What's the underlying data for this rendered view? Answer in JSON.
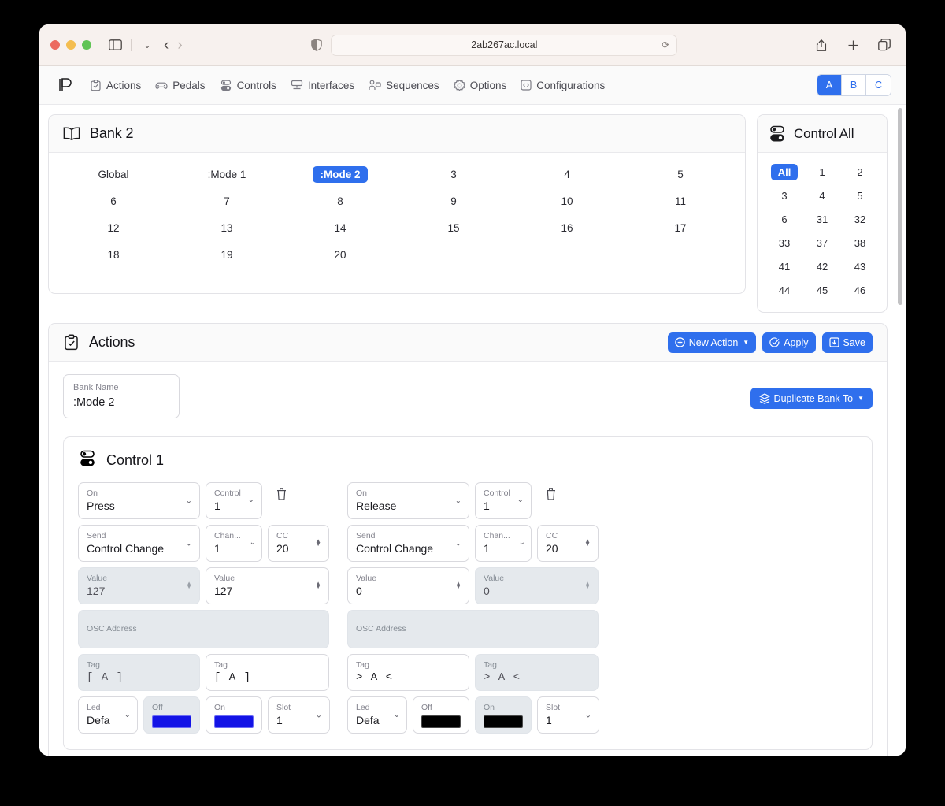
{
  "browser": {
    "url": "2ab267ac.local",
    "icons": {
      "sidebar": "sidebar-icon",
      "sidebar_chevron": "chevron-down-icon",
      "back": "back-arrow-icon",
      "forward": "forward-arrow-icon",
      "shield": "shield-icon",
      "reload": "reload-icon",
      "share": "share-icon",
      "new_tab": "plus-icon",
      "tabs": "tab-overview-icon"
    }
  },
  "appnav": {
    "logo": "pedal-logo-icon",
    "items": [
      {
        "label": "Actions",
        "icon": "clipboard-check-icon"
      },
      {
        "label": "Pedals",
        "icon": "gamepad-icon"
      },
      {
        "label": "Controls",
        "icon": "toggles-icon"
      },
      {
        "label": "Interfaces",
        "icon": "interface-icon"
      },
      {
        "label": "Sequences",
        "icon": "sequences-icon"
      },
      {
        "label": "Options",
        "icon": "gear-icon"
      },
      {
        "label": "Configurations",
        "icon": "config-icon"
      }
    ],
    "abc": {
      "options": [
        "A",
        "B",
        "C"
      ],
      "selected": "A"
    }
  },
  "bank": {
    "title": "Bank 2",
    "icon": "book-icon",
    "cells": [
      {
        "label": "Global",
        "selected": false
      },
      {
        "label": ":Mode 1",
        "selected": false
      },
      {
        "label": ":Mode 2",
        "selected": true
      },
      {
        "label": "3",
        "selected": false
      },
      {
        "label": "4",
        "selected": false
      },
      {
        "label": "5",
        "selected": false
      },
      {
        "label": "6",
        "selected": false
      },
      {
        "label": "7",
        "selected": false
      },
      {
        "label": "8",
        "selected": false
      },
      {
        "label": "9",
        "selected": false
      },
      {
        "label": "10",
        "selected": false
      },
      {
        "label": "11",
        "selected": false
      },
      {
        "label": "12",
        "selected": false
      },
      {
        "label": "13",
        "selected": false
      },
      {
        "label": "14",
        "selected": false
      },
      {
        "label": "15",
        "selected": false
      },
      {
        "label": "16",
        "selected": false
      },
      {
        "label": "17",
        "selected": false
      },
      {
        "label": "18",
        "selected": false
      },
      {
        "label": "19",
        "selected": false
      },
      {
        "label": "20",
        "selected": false
      }
    ]
  },
  "control_all": {
    "title": "Control All",
    "icon": "toggles-icon",
    "cells": [
      {
        "label": "All",
        "selected": true
      },
      {
        "label": "1",
        "selected": false
      },
      {
        "label": "2",
        "selected": false
      },
      {
        "label": "3",
        "selected": false
      },
      {
        "label": "4",
        "selected": false
      },
      {
        "label": "5",
        "selected": false
      },
      {
        "label": "6",
        "selected": false
      },
      {
        "label": "31",
        "selected": false
      },
      {
        "label": "32",
        "selected": false
      },
      {
        "label": "33",
        "selected": false
      },
      {
        "label": "37",
        "selected": false
      },
      {
        "label": "38",
        "selected": false
      },
      {
        "label": "41",
        "selected": false
      },
      {
        "label": "42",
        "selected": false
      },
      {
        "label": "43",
        "selected": false
      },
      {
        "label": "44",
        "selected": false
      },
      {
        "label": "45",
        "selected": false
      },
      {
        "label": "46",
        "selected": false
      }
    ]
  },
  "actions": {
    "title": "Actions",
    "icon": "clipboard-check-icon",
    "new_action_label": "New Action",
    "apply_label": "Apply",
    "save_label": "Save",
    "duplicate_label": "Duplicate Bank To",
    "bank_name": {
      "label": "Bank Name",
      "value": ":Mode 2"
    }
  },
  "control_panel": {
    "title": "Control 1",
    "icon": "toggles-icon",
    "groups": [
      {
        "on": {
          "label": "On",
          "value": "Press"
        },
        "control": {
          "label": "Control",
          "value": "1"
        },
        "send": {
          "label": "Send",
          "value": "Control Change"
        },
        "channel": {
          "label": "Chan...",
          "value": "1"
        },
        "cc": {
          "label": "CC",
          "value": "20"
        },
        "value_a": {
          "label": "Value",
          "value": "127",
          "disabled": true
        },
        "value_b": {
          "label": "Value",
          "value": "127",
          "disabled": false
        },
        "osc": {
          "label": "OSC Address",
          "value": ""
        },
        "tag_a": {
          "label": "Tag",
          "value": "[  A  ]",
          "disabled": true
        },
        "tag_b": {
          "label": "Tag",
          "value": "[  A  ]",
          "disabled": false
        },
        "led": {
          "label": "Led",
          "value": "Defa"
        },
        "off": {
          "label": "Off",
          "color": "#1313e6",
          "disabled": true
        },
        "onled": {
          "label": "On",
          "color": "#1313e6",
          "disabled": false
        },
        "slot": {
          "label": "Slot",
          "value": "1"
        },
        "delete_icon": "trash-icon"
      },
      {
        "on": {
          "label": "On",
          "value": "Release"
        },
        "control": {
          "label": "Control",
          "value": "1"
        },
        "send": {
          "label": "Send",
          "value": "Control Change"
        },
        "channel": {
          "label": "Chan...",
          "value": "1"
        },
        "cc": {
          "label": "CC",
          "value": "20"
        },
        "value_a": {
          "label": "Value",
          "value": "0",
          "disabled": false
        },
        "value_b": {
          "label": "Value",
          "value": "0",
          "disabled": true
        },
        "osc": {
          "label": "OSC Address",
          "value": ""
        },
        "tag_a": {
          "label": "Tag",
          "value": ">  A  <",
          "disabled": false
        },
        "tag_b": {
          "label": "Tag",
          "value": ">  A  <",
          "disabled": true
        },
        "led": {
          "label": "Led",
          "value": "Defa"
        },
        "off": {
          "label": "Off",
          "color": "#000000",
          "disabled": false
        },
        "onled": {
          "label": "On",
          "color": "#000000",
          "disabled": true
        },
        "slot": {
          "label": "Slot",
          "value": "1"
        },
        "delete_icon": "trash-icon"
      }
    ]
  },
  "colors": {
    "accent": "#2f6fed",
    "led_blue": "#1313e6",
    "led_black": "#000000"
  }
}
